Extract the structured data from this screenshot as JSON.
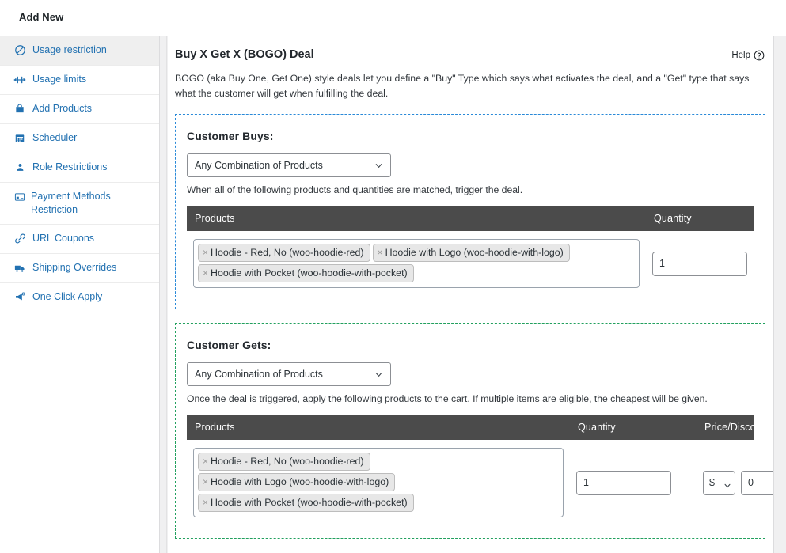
{
  "topbar": {
    "title": "Add New"
  },
  "sidebar": {
    "items": [
      {
        "label": "Usage restriction",
        "icon": "no-entry-icon",
        "active": true,
        "wrap": false
      },
      {
        "label": "Usage limits",
        "icon": "limits-icon",
        "active": false,
        "wrap": false
      },
      {
        "label": "Add Products",
        "icon": "bag-icon",
        "active": false,
        "wrap": false
      },
      {
        "label": "Scheduler",
        "icon": "calendar-icon",
        "active": false,
        "wrap": false
      },
      {
        "label": "Role Restrictions",
        "icon": "user-icon",
        "active": false,
        "wrap": false
      },
      {
        "label": "Payment Methods Restriction",
        "icon": "credit-card-icon",
        "active": false,
        "wrap": true
      },
      {
        "label": "URL Coupons",
        "icon": "link-icon",
        "active": false,
        "wrap": false
      },
      {
        "label": "Shipping Overrides",
        "icon": "truck-icon",
        "active": false,
        "wrap": false
      },
      {
        "label": "One Click Apply",
        "icon": "megaphone-icon",
        "active": false,
        "wrap": false
      }
    ]
  },
  "panel": {
    "title": "Buy X Get X (BOGO) Deal",
    "help_label": "Help",
    "help_icon": "question-circle-icon",
    "description": "BOGO (aka Buy One, Get One) style deals let you define a \"Buy\" Type which says what activates the deal, and a \"Get\" type that says what the customer will get when fulfilling the deal."
  },
  "customer_buys": {
    "heading": "Customer Buys:",
    "type_selected": "Any Combination of Products",
    "hint": "When all of the following products and quantities are matched, trigger the deal.",
    "columns": {
      "products": "Products",
      "quantity": "Quantity"
    },
    "products": [
      "Hoodie - Red, No (woo-hoodie-red)",
      "Hoodie with Logo (woo-hoodie-with-logo)",
      "Hoodie with Pocket (woo-hoodie-with-pocket)"
    ],
    "remove_glyph": "×",
    "quantity_value": "1"
  },
  "customer_gets": {
    "heading": "Customer Gets:",
    "type_selected": "Any Combination of Products",
    "hint": "Once the deal is triggered, apply the following products to the cart. If multiple items are eligible, the cheapest will be given.",
    "columns": {
      "products": "Products",
      "quantity": "Quantity",
      "price": "Price/Discount"
    },
    "products": [
      "Hoodie - Red, No (woo-hoodie-red)",
      "Hoodie with Logo (woo-hoodie-with-logo)",
      "Hoodie with Pocket (woo-hoodie-with-pocket)"
    ],
    "remove_glyph": "×",
    "quantity_value": "1",
    "currency_selected": "$",
    "price_value": "0"
  },
  "colors": {
    "link_blue": "#2271b1",
    "buys_border": "#2989d8",
    "gets_border": "#22a05e",
    "table_header_bg": "#4b4b4b",
    "page_bg": "#f0f0f1"
  }
}
